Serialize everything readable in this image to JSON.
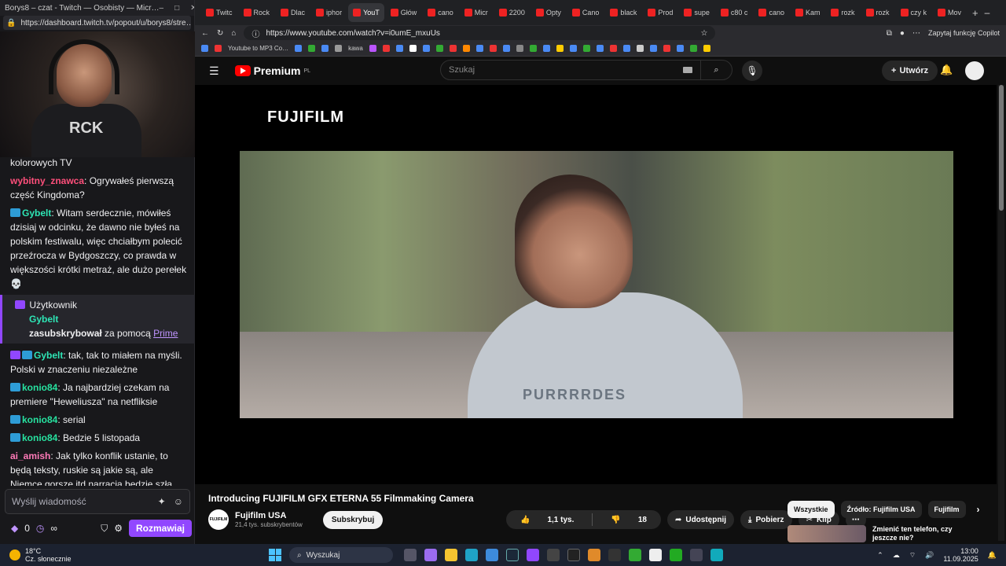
{
  "twitch": {
    "window_title": "Borys8 – czat - Twitch — Osobisty — Micr…",
    "url": "https://dashboard.twitch.tv/popout/u/borys8/stre…",
    "webcam_shirt_text": "RCK",
    "chat": [
      {
        "text": "kolorowych TV"
      },
      {
        "user": "wybitny_znawca",
        "user_color": "#ff4f7b",
        "text": ": Ogrywałeś pierwszą część Kingdoma?"
      },
      {
        "user": "Gybelt",
        "user_color": "#2ee6b6",
        "badge": true,
        "text": ": Witam serdecznie, mówiłeś dzisiaj w odcinku, że dawno nie byłeś na polskim festiwalu, więc chciałbym polecić przeźrocza w Bydgoszczy, co prawda w większości krótki metraż, ale dużo perełek 💀"
      },
      {
        "user": "Gybelt",
        "user_color": "#2ee6b6",
        "badge": true,
        "badge2": true,
        "text": ": tak, tak to miałem na myśli. Polski w znaczeniu niezależne"
      },
      {
        "user": "konio84",
        "user_color": "#27e2a0",
        "badge": true,
        "text": ": Ja najbardziej czekam na premiere \"Heweliusza\" na netfliksie"
      },
      {
        "user": "konio84",
        "user_color": "#27e2a0",
        "badge": true,
        "text": ": serial"
      },
      {
        "user": "konio84",
        "user_color": "#27e2a0",
        "badge": true,
        "text": ": Bedzie 5 listopada"
      },
      {
        "user": "ai_amish",
        "user_color": "#ff7ab8",
        "text": ": Jak tylko konflik ustanie, to będą teksty, ruskie są jakie są, ale Niemce gorsze itd narracja będzie szła."
      }
    ],
    "sub_notice": {
      "title": "Użytkownik",
      "user": "Gybelt",
      "action": "zasubskrybował",
      "via": "za pomocą",
      "link": "Prime"
    },
    "input_placeholder": "Wyślij wiadomość",
    "points": "0",
    "infinity": "∞",
    "chat_button": "Rozmawiaj"
  },
  "browser": {
    "tabs": [
      "Twitc",
      "Rock",
      "Dlac",
      "iphor",
      "YouT",
      "Głów",
      "cano",
      "Micr",
      "2200",
      "Opty",
      "Cano",
      "black",
      "Prod",
      "supe",
      "c80 c",
      "cano",
      "Kam",
      "rozk",
      "rozk",
      "czy k",
      "Mov"
    ],
    "active_tab_index": 4,
    "url": "https://www.youtube.com/watch?v=i0umE_mxuUs",
    "copilot": "Zapytaj funkcję Copilot",
    "bookmarks": [
      "Youtube to MP3 Co…",
      "kawa"
    ]
  },
  "youtube": {
    "logo": "Premium",
    "region": "PL",
    "search_placeholder": "Szukaj",
    "create": "Utwórz",
    "video_brand": "FUJIFILM",
    "video_print": "PURRRRDES",
    "title": "Introducing FUJIFILM GFX ETERNA 55 Filmmaking Camera",
    "channel": "Fujifilm USA",
    "channel_avatar": "FUJIFILM",
    "subscribers": "21,4 tys. subskrybentów",
    "subscribe": "Subskrybuj",
    "likes": "1,1 tys.",
    "dislikes": "18",
    "share": "Udostępnij",
    "download": "Pobierz",
    "clip": "Klip",
    "chips": [
      "Wszystkie",
      "Źródło: Fujifilm USA",
      "Fujifilm"
    ],
    "rec_title": "Zmienić ten telefon, czy jeszcze nie?"
  },
  "taskbar": {
    "temp": "18°C",
    "weather": "Cz. słonecznie",
    "search": "Wyszukaj",
    "time": "13:00",
    "date": "11.09.2025"
  }
}
